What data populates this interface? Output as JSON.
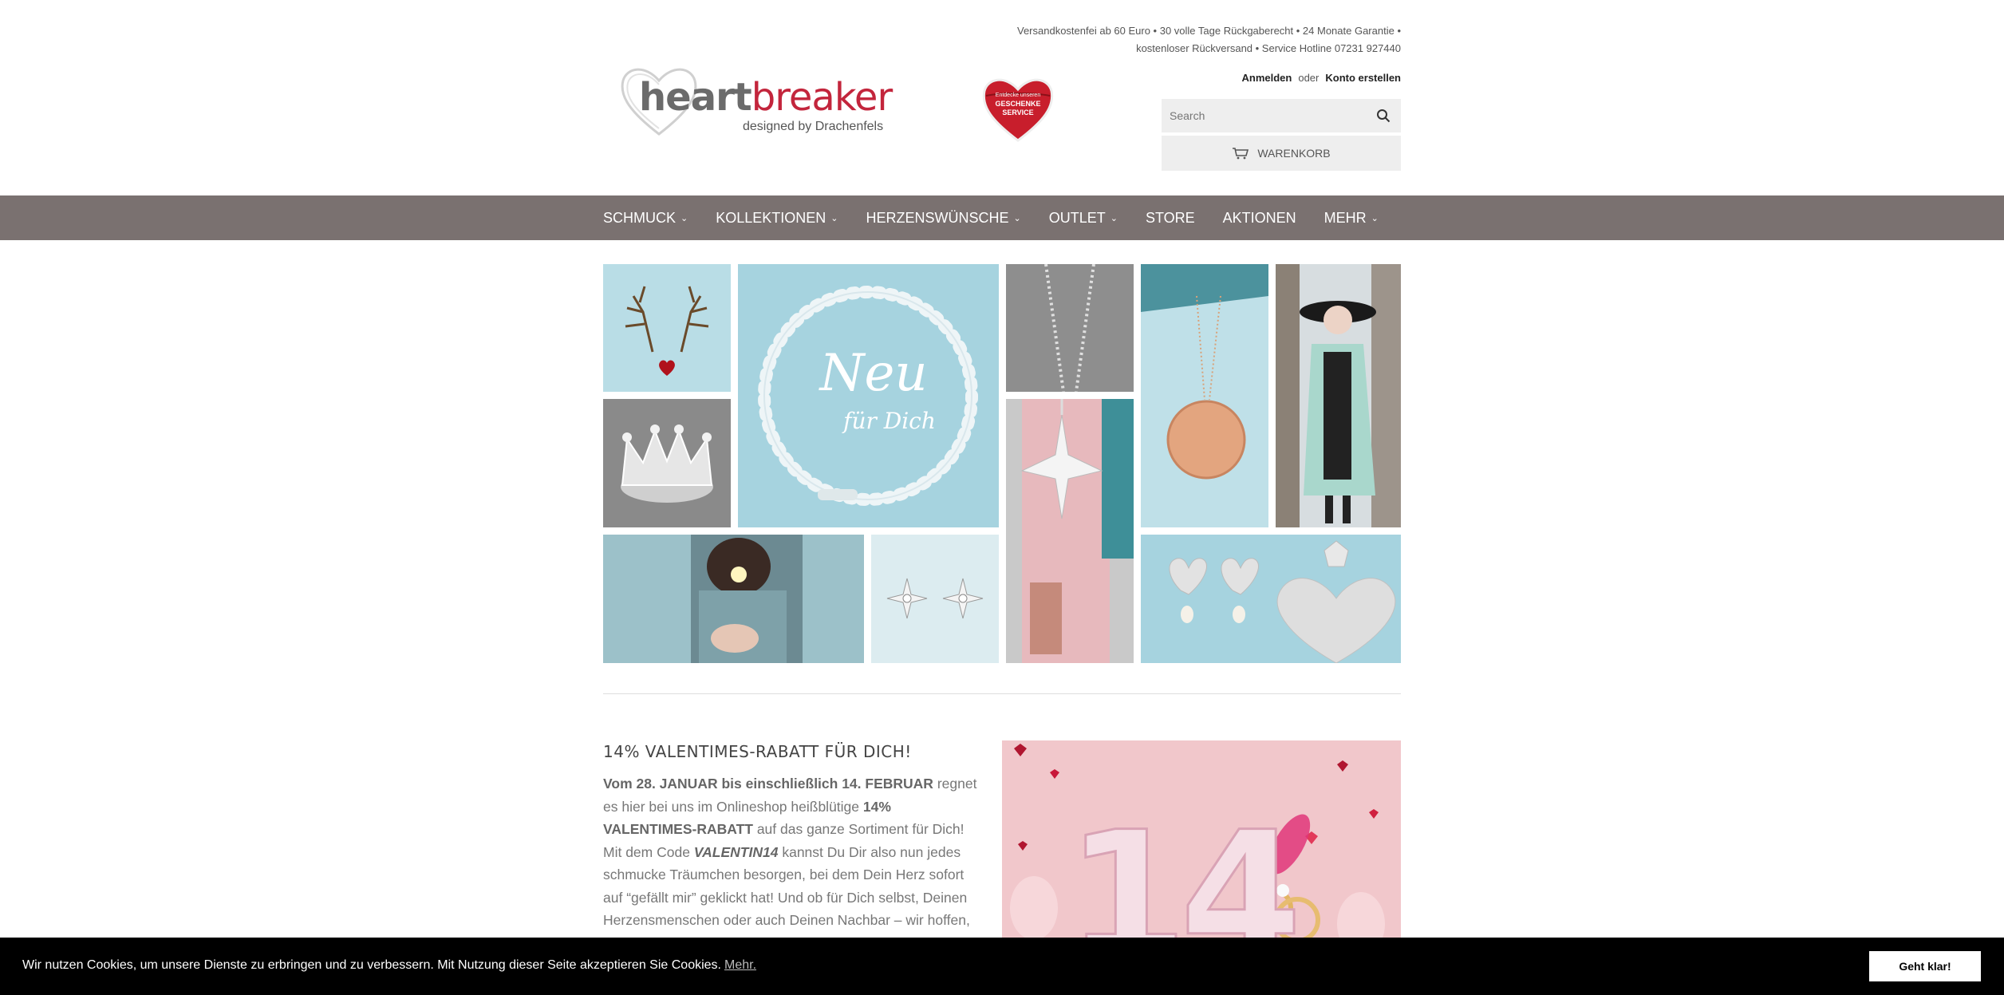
{
  "header": {
    "info_line1": "Versandkostenfei ab 60 Euro • 30 volle Tage Rückgaberecht • 24 Monate Garantie •",
    "info_line2": "kostenloser Rückversand • Service Hotline 07231 927440",
    "logo_part1": "heart",
    "logo_part2": "breaker",
    "logo_tagline": "designed by Drachenfels",
    "gift_line1": "Entdecke unseren",
    "gift_line2": "GESCHENKE",
    "gift_line3": "SERVICE",
    "login_label": "Anmelden",
    "or_label": "oder",
    "register_label": "Konto erstellen",
    "search_placeholder": "Search",
    "cart_label": "WARENKORB"
  },
  "nav": {
    "items": [
      {
        "label": "SCHMUCK",
        "dropdown": true
      },
      {
        "label": "KOLLEKTIONEN",
        "dropdown": true
      },
      {
        "label": "HERZENSWÜNSCHE",
        "dropdown": true
      },
      {
        "label": "OUTLET",
        "dropdown": true
      },
      {
        "label": "STORE",
        "dropdown": false
      },
      {
        "label": "AKTIONEN",
        "dropdown": false
      },
      {
        "label": "MEHR",
        "dropdown": true
      }
    ]
  },
  "collage": {
    "banner_script_big": "Neu",
    "banner_script_small": "für Dich"
  },
  "promo": {
    "title": "14% VALENTIMES-RABATT FÜR DICH!",
    "p_bold1": "Vom 28. JANUAR bis einschließlich 14. FEBRUAR",
    "p_text1": " regnet es hier bei uns im Onlineshop heißblütige ",
    "p_bold2": "14% VALENTIMES-RABATT",
    "p_text2": " auf das ganze Sortiment für Dich! Mit dem Code ",
    "p_code": "VALENTIN14",
    "p_text3": " kannst Du Dir also nun jedes schmucke Träumchen besorgen, bei dem Dein Herz sofort auf “gefällt mir” geklickt hat! Und ob für Dich selbst, Deinen Herzensmenschen oder auch Deinen Nachbar – wir hoffen,",
    "image_numbers": "14"
  },
  "cookie": {
    "message": "Wir nutzen Cookies, um unsere Dienste zu erbringen und zu verbessern. Mit Nutzung dieser Seite akzeptieren Sie Cookies.",
    "more_link": "Mehr.",
    "accept_label": "Geht klar!"
  },
  "colors": {
    "nav_bg": "#7a7170",
    "brand_red": "#c3253c",
    "tile_blue": "#a6d3df",
    "tile_grey": "#8e8e8e"
  }
}
